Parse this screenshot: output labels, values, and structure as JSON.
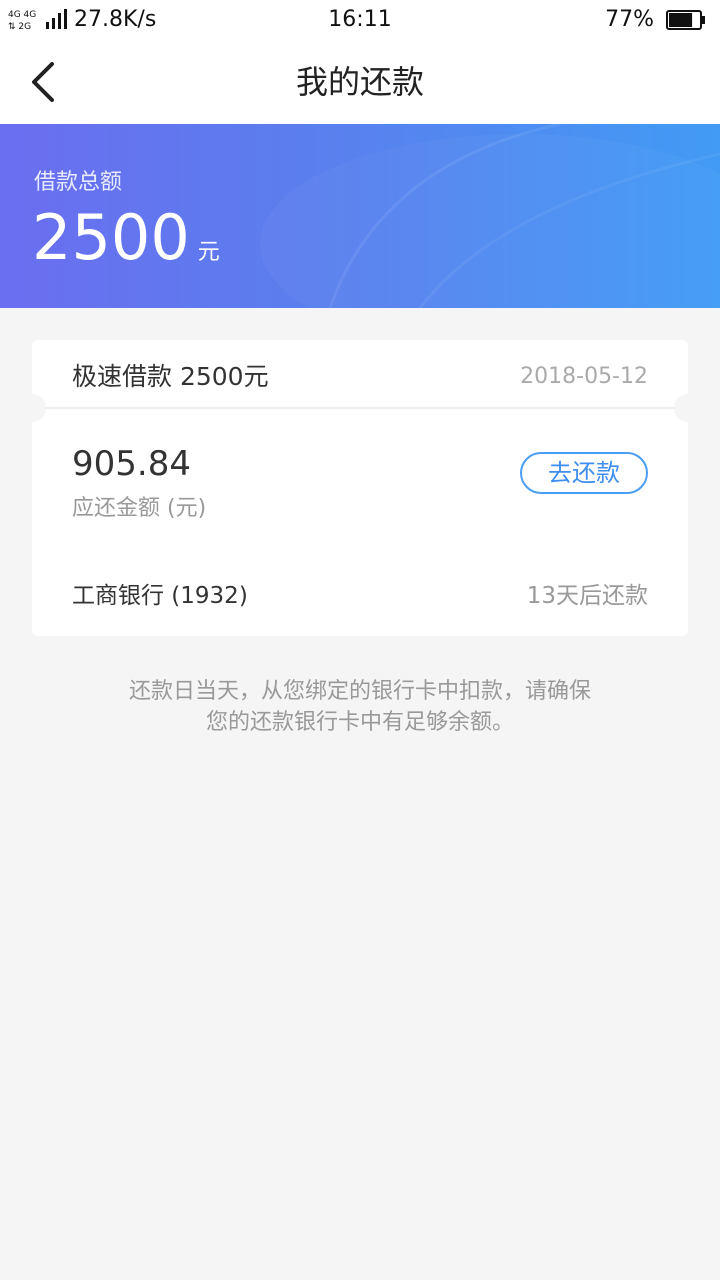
{
  "status_bar": {
    "net_types": "4G 4G 2G",
    "net_speed": "27.8K/s",
    "time": "16:11",
    "battery_pct": "77%",
    "battery_level": 0.77
  },
  "nav": {
    "title": "我的还款",
    "back_icon": "chevron-left-icon"
  },
  "hero": {
    "label": "借款总额",
    "amount": "2500",
    "unit": "元",
    "gradient": [
      "#6a6ef0",
      "#419bf5"
    ]
  },
  "loan_card": {
    "title": "极速借款 2500元",
    "date": "2018-05-12",
    "due_amount": "905.84",
    "due_label": "应还金额 (元)",
    "repay_button": "去还款",
    "bank": "工商银行 (1932)",
    "countdown": "13天后还款",
    "accent_color": "#3d8ef0"
  },
  "notice": {
    "line1": "还款日当天，从您绑定的银行卡中扣款，请确保",
    "line2": "您的还款银行卡中有足够余额。"
  }
}
